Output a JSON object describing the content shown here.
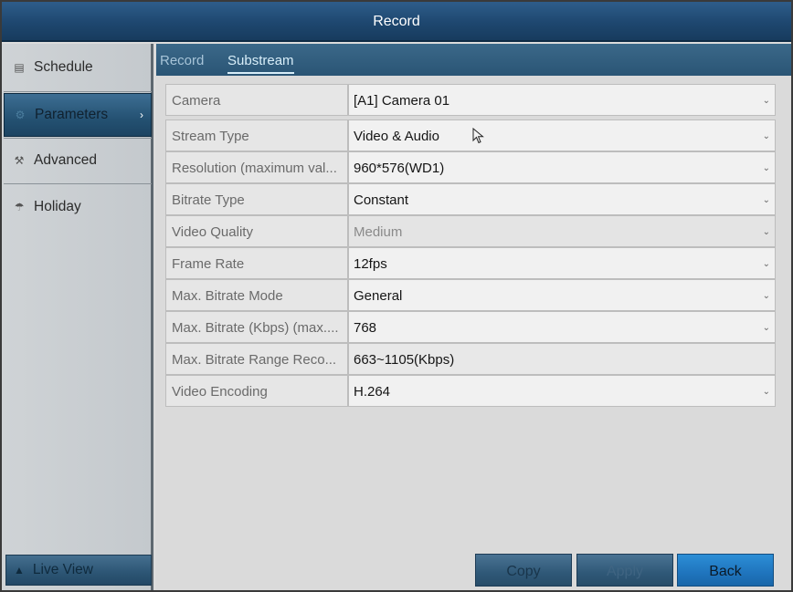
{
  "window": {
    "title": "Record"
  },
  "sidebar": {
    "items": [
      {
        "label": "Schedule",
        "icon": "calendar-icon"
      },
      {
        "label": "Parameters",
        "icon": "gear-icon",
        "active": true
      },
      {
        "label": "Advanced",
        "icon": "settings-icon"
      },
      {
        "label": "Holiday",
        "icon": "umbrella-icon"
      }
    ],
    "live_view": {
      "label": "Live View",
      "icon": "home-icon"
    }
  },
  "tabs": [
    {
      "label": "Record"
    },
    {
      "label": "Substream",
      "selected": true
    }
  ],
  "form": {
    "camera": {
      "label": "Camera",
      "value": "[A1] Camera 01"
    },
    "fields": [
      {
        "label": "Stream Type",
        "value": "Video & Audio"
      },
      {
        "label": "Resolution (maximum val...",
        "value": "960*576(WD1)"
      },
      {
        "label": "Bitrate Type",
        "value": "Constant"
      },
      {
        "label": "Video Quality",
        "value": "Medium"
      },
      {
        "label": "Frame Rate",
        "value": "12fps"
      },
      {
        "label": "Max. Bitrate Mode",
        "value": "General"
      },
      {
        "label": "Max. Bitrate (Kbps) (max....",
        "value": "768"
      },
      {
        "label": "Max. Bitrate Range Reco...",
        "value": "663~1105(Kbps)"
      },
      {
        "label": "Video Encoding",
        "value": "H.264"
      }
    ]
  },
  "buttons": {
    "copy": "Copy",
    "apply": "Apply",
    "back": "Back"
  },
  "colors": {
    "accent": "#1f74bd",
    "titlebar": "#1e476f",
    "tab_bar": "#2a5575"
  }
}
